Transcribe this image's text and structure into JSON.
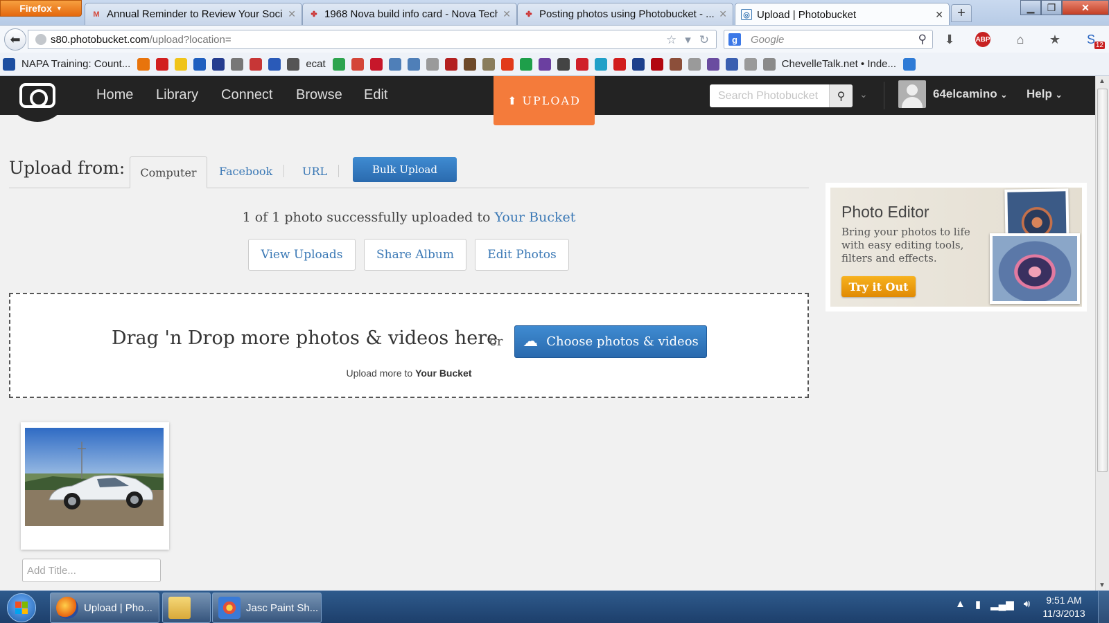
{
  "browser": {
    "menu_label": "Firefox",
    "tabs": [
      {
        "label": "Annual Reminder to Review Your Soci...",
        "icon": "gmail-icon",
        "active": false
      },
      {
        "label": "1968 Nova build info card - Nova Tech",
        "icon": "forum-icon",
        "active": false
      },
      {
        "label": "Posting photos using Photobucket - ...",
        "icon": "forum-icon",
        "active": false
      },
      {
        "label": "Upload | Photobucket",
        "icon": "photobucket-icon",
        "active": true
      }
    ],
    "url_scheme_host": "s80.photobucket.com",
    "url_path": "/upload?location=",
    "search_placeholder": "Google",
    "search_engine_letter": "g",
    "adblock_label": "ABP",
    "notification_count": "12"
  },
  "bookmarks": [
    {
      "label": "NAPA Training: Count...",
      "color": "#1d4fa1"
    },
    {
      "label": "",
      "color": "#e8740c"
    },
    {
      "label": "",
      "color": "#d21f1f"
    },
    {
      "label": "",
      "color": "#f0c419"
    },
    {
      "label": "",
      "color": "#1f5fbf"
    },
    {
      "label": "",
      "color": "#243c8f"
    },
    {
      "label": "",
      "color": "#777777"
    },
    {
      "label": "",
      "color": "#c73636"
    },
    {
      "label": "",
      "color": "#2a5ab8"
    },
    {
      "label": "ecat",
      "color": "#555555"
    },
    {
      "label": "",
      "color": "#2da44e"
    },
    {
      "label": "",
      "color": "#d44638"
    },
    {
      "label": "",
      "color": "#c7172a"
    },
    {
      "label": "",
      "color": "#4f7fb8"
    },
    {
      "label": "",
      "color": "#4f7fb8"
    },
    {
      "label": "",
      "color": "#9a9a9a"
    },
    {
      "label": "",
      "color": "#b32020"
    },
    {
      "label": "",
      "color": "#6e4a2a"
    },
    {
      "label": "",
      "color": "#8a7d5c"
    },
    {
      "label": "",
      "color": "#e23a1a"
    },
    {
      "label": "",
      "color": "#1e9f4a"
    },
    {
      "label": "",
      "color": "#6b3fa0"
    },
    {
      "label": "",
      "color": "#444444"
    },
    {
      "label": "",
      "color": "#d0202a"
    },
    {
      "label": "",
      "color": "#21a0c8"
    },
    {
      "label": "",
      "color": "#d11d1d"
    },
    {
      "label": "",
      "color": "#1c3f8c"
    },
    {
      "label": "",
      "color": "#b20710"
    },
    {
      "label": "",
      "color": "#8c4f3a"
    },
    {
      "label": "",
      "color": "#9a9a9a"
    },
    {
      "label": "",
      "color": "#6a4ca0"
    },
    {
      "label": "",
      "color": "#3a5fb0"
    },
    {
      "label": "",
      "color": "#9a9a9a"
    },
    {
      "label": "ChevelleTalk.net • Inde...",
      "color": "#8a8a8a"
    },
    {
      "label": "",
      "color": "#2e7bd6"
    }
  ],
  "photobucket": {
    "nav": [
      "Home",
      "Library",
      "Connect",
      "Browse",
      "Edit"
    ],
    "upload_label": "UPLOAD",
    "search_placeholder": "Search Photobucket",
    "username": "64elcamino",
    "help_label": "Help",
    "upload_from_label": "Upload from:",
    "source_tabs": [
      "Computer",
      "Facebook",
      "URL"
    ],
    "bulk_upload_label": "Bulk Upload",
    "success_prefix": "1 of 1 photo successfully uploaded to",
    "success_bucket": "Your Bucket",
    "action_buttons": [
      "View Uploads",
      "Share Album",
      "Edit Photos"
    ],
    "drop_text": "Drag 'n Drop more photos & videos here",
    "drop_or": "or",
    "choose_label": "Choose photos & videos",
    "drop_sub_prefix": "Upload more to",
    "drop_sub_bucket": "Your Bucket",
    "title_placeholder": "Add Title...",
    "colors": {
      "header": "#232323",
      "upload_orange": "#f47b3b",
      "link_blue": "#3a78b5",
      "button_blue": "#2f78c2"
    }
  },
  "promo": {
    "title": "Photo Editor",
    "body": "Bring your photos to life with easy editing tools, filters and effects.",
    "button": "Try it Out"
  },
  "taskbar": {
    "items": [
      {
        "label": "Upload | Pho...",
        "icon": "firefox-icon"
      },
      {
        "label": "",
        "icon": "folder-icon"
      },
      {
        "label": "Jasc Paint Sh...",
        "icon": "paintshop-icon"
      }
    ],
    "time": "9:51 AM",
    "date": "11/3/2013"
  }
}
